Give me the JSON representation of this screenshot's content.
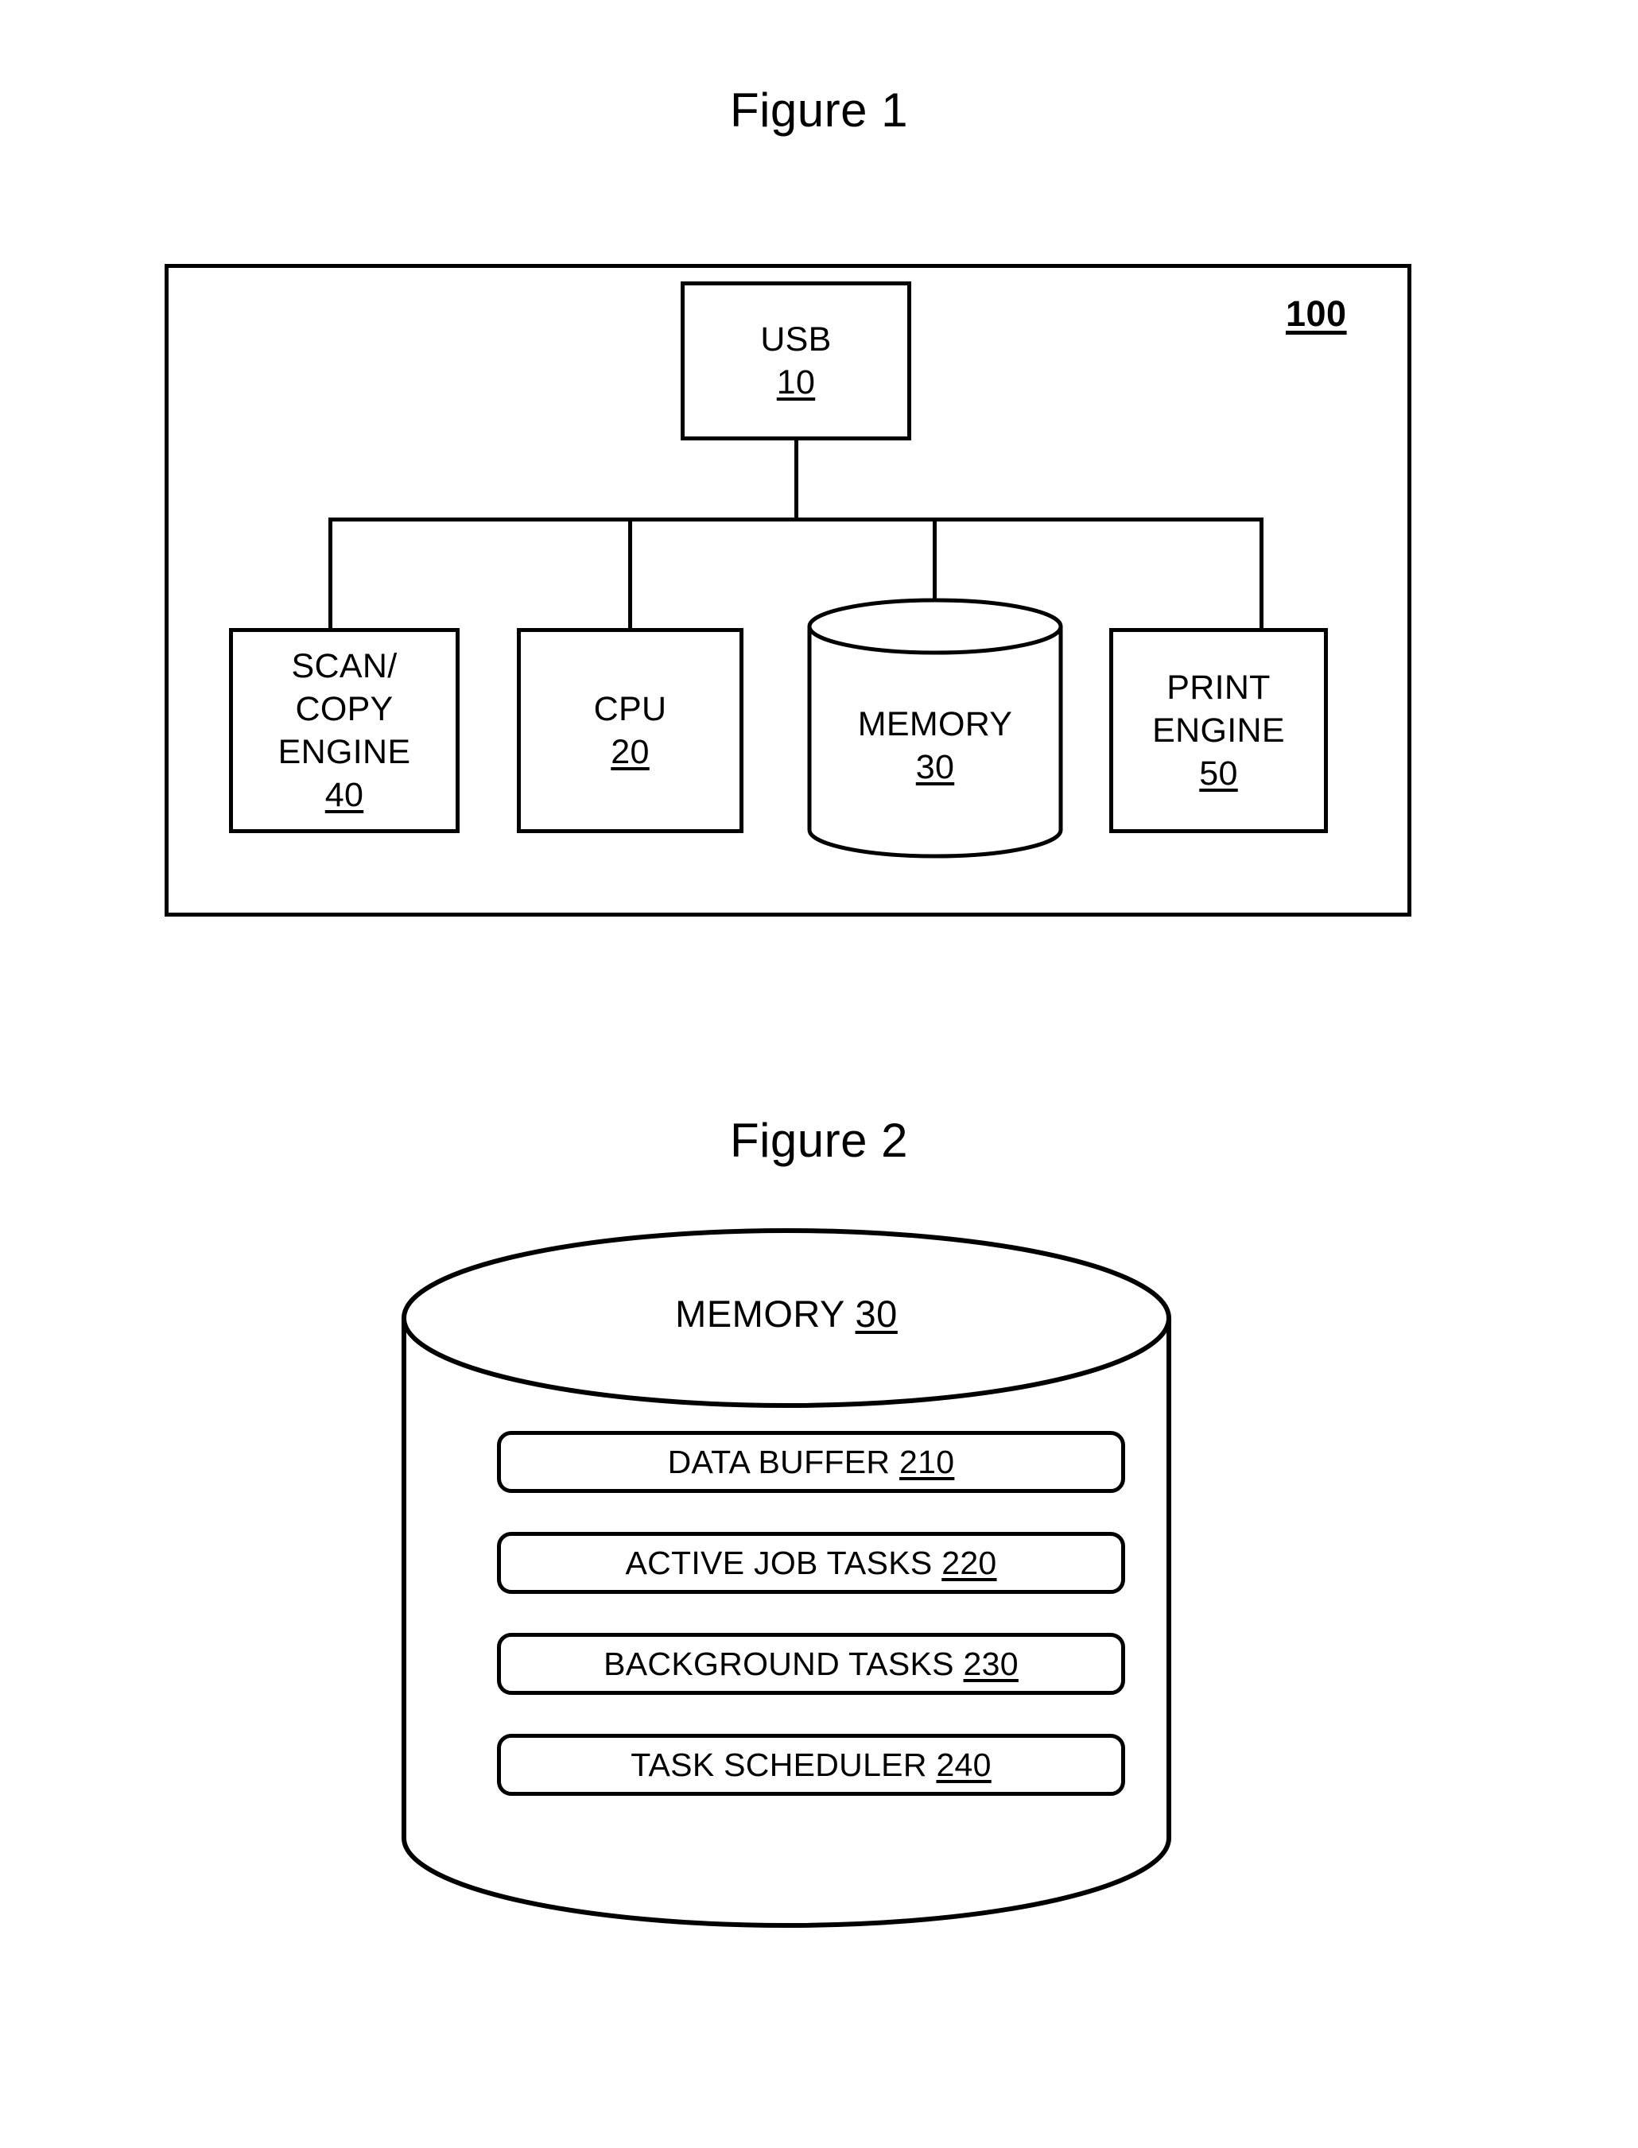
{
  "figure1": {
    "title": "Figure 1",
    "system_ref": "100",
    "nodes": [
      {
        "id": "usb",
        "lines": [
          "USB"
        ],
        "ref": "10",
        "shape": "rect"
      },
      {
        "id": "scan",
        "lines": [
          "SCAN/",
          "COPY",
          "ENGINE"
        ],
        "ref": "40",
        "shape": "rect"
      },
      {
        "id": "cpu",
        "lines": [
          "CPU"
        ],
        "ref": "20",
        "shape": "rect"
      },
      {
        "id": "memory",
        "lines": [
          "MEMORY"
        ],
        "ref": "30",
        "shape": "cylinder"
      },
      {
        "id": "print",
        "lines": [
          "PRINT",
          "ENGINE"
        ],
        "ref": "50",
        "shape": "rect"
      }
    ]
  },
  "figure2": {
    "title": "Figure 2",
    "memory_label": "MEMORY",
    "memory_ref": "30",
    "components": [
      {
        "label": "DATA BUFFER",
        "ref": "210"
      },
      {
        "label": "ACTIVE JOB TASKS",
        "ref": "220"
      },
      {
        "label": "BACKGROUND TASKS",
        "ref": "230"
      },
      {
        "label": "TASK SCHEDULER",
        "ref": "240"
      }
    ]
  }
}
